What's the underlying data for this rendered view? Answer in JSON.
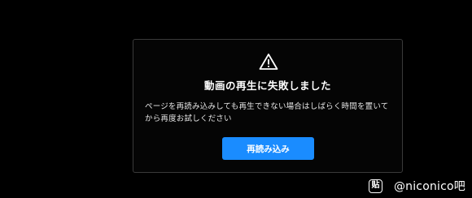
{
  "player_error": {
    "icon": "warning-triangle-icon",
    "title": "動画の再生に失敗しました",
    "message_line1": "ページを再読み込みしても再生できない場合はしばらく時間を置いて",
    "message_line2": "から再度お試しください",
    "reload_label": "再読み込み",
    "accent_color": "#1a8cff"
  },
  "watermark": {
    "logo_icon": "tieba-logo-icon",
    "text": "@niconico吧"
  }
}
